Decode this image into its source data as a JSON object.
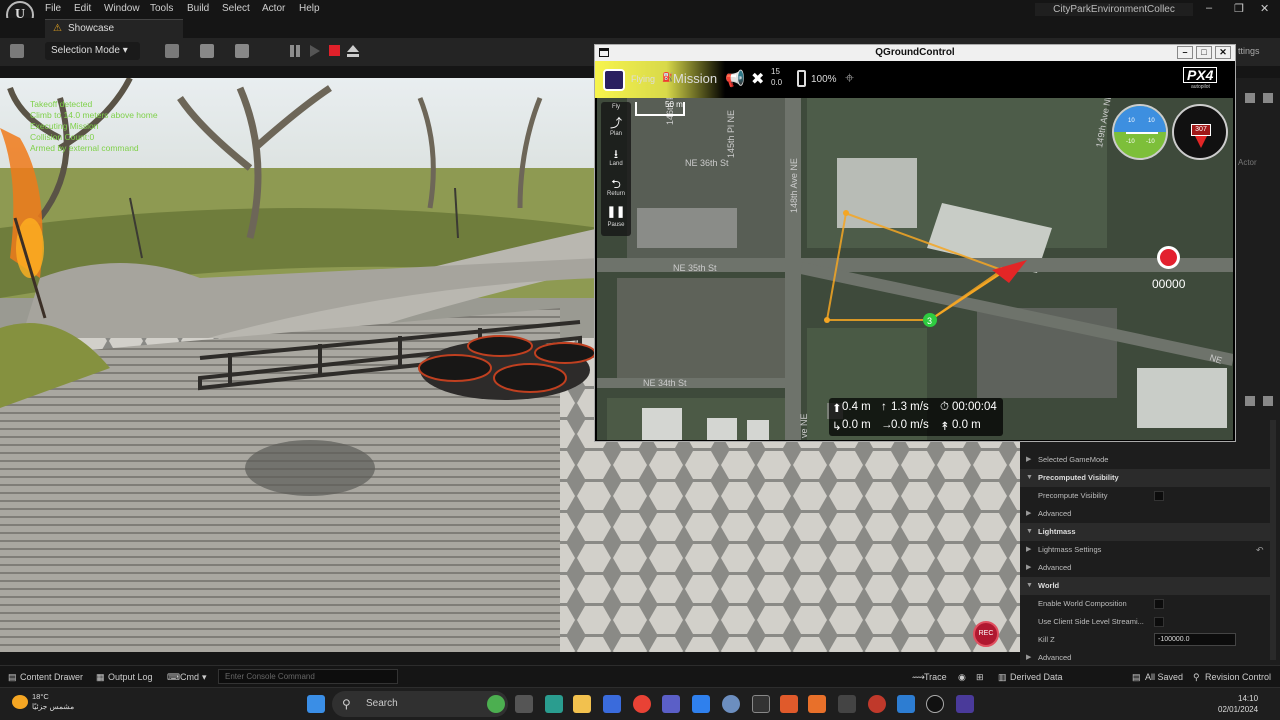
{
  "unreal": {
    "logo": "U",
    "menu": [
      "File",
      "Edit",
      "Window",
      "Tools",
      "Build",
      "Select",
      "Actor",
      "Help"
    ],
    "project_title": "CityParkEnvironmentCollec",
    "tab": "Showcase",
    "selection_mode": "Selection Mode",
    "settings_partial": "ttings",
    "actor_partial": "Actor",
    "viewport_log": [
      "Takeoff detected",
      "Climb to 14.0 meters above home",
      "Executing Mission",
      "Collision Count:0",
      "Armed by external command"
    ],
    "rec_label": "REC",
    "details_rows": [
      {
        "label": "Selected GameMode",
        "kind": "item"
      },
      {
        "label": "Precomputed Visibility",
        "kind": "category"
      },
      {
        "label": "Precompute Visibility",
        "kind": "check"
      },
      {
        "label": "Advanced",
        "kind": "item"
      },
      {
        "label": "Lightmass",
        "kind": "category"
      },
      {
        "label": "Lightmass Settings",
        "kind": "item"
      },
      {
        "label": "Advanced",
        "kind": "item"
      },
      {
        "label": "World",
        "kind": "category"
      },
      {
        "label": "Enable World Composition",
        "kind": "check"
      },
      {
        "label": "Use Client Side Level Streami...",
        "kind": "check"
      },
      {
        "label": "Kill Z",
        "kind": "input",
        "value": "-100000.0"
      },
      {
        "label": "Advanced",
        "kind": "item"
      }
    ],
    "bottom_bar": {
      "content_drawer": "Content Drawer",
      "output_log": "Output Log",
      "cmd": "Cmd",
      "console_placeholder": "Enter Console Command",
      "trace": "Trace",
      "derived_data": "Derived Data",
      "all_saved": "All Saved",
      "revision_control": "Revision Control"
    }
  },
  "qgc": {
    "window_title": "QGroundControl",
    "flight_mode": "Flying",
    "mission": "Mission",
    "satellites": "15",
    "hdop": "0.0",
    "battery": "100%",
    "brand": "PX4",
    "brand_sub": "autopilot",
    "scale": "50 m",
    "tools": [
      "Plan",
      "Land",
      "Return",
      "Pause"
    ],
    "streets": [
      "146th Pl NE",
      "NE 36th St",
      "148th Ave NE",
      "NE 35th St",
      "NE 34th St",
      "NE",
      "ve NE",
      "145th Pl NE",
      "149th Ave NE"
    ],
    "compass_heading": "307",
    "attitude_marks": [
      "10",
      "10",
      "-10",
      "-10"
    ],
    "record_counter": "00000",
    "waypoint_labels": [
      "3"
    ],
    "telemetry": {
      "altitude": "0.4 m",
      "vertical_speed": "1.3 m/s",
      "flight_time": "00:00:04",
      "distance": "0.0 m",
      "ground_speed": "0.0 m/s",
      "distance_to_home": "0.0 m"
    }
  },
  "taskbar": {
    "weather_temp": "18°C",
    "weather_desc": "مشمس جزئيًا",
    "search": "Search",
    "time": "14:10",
    "date": "02/01/2024"
  }
}
